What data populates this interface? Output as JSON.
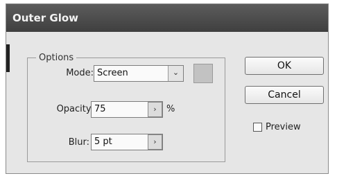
{
  "window": {
    "title": "Outer Glow"
  },
  "options": {
    "legend": "Options",
    "mode": {
      "label": "Mode:",
      "value": "Screen"
    },
    "opacity": {
      "label": "Opacity:",
      "value": "75",
      "unit": "%"
    },
    "blur": {
      "label": "Blur:",
      "value": "5 pt"
    },
    "glow_color": "#c2c2c2"
  },
  "buttons": {
    "ok": "OK",
    "cancel": "Cancel"
  },
  "preview": {
    "label": "Preview",
    "checked": false
  },
  "icons": {
    "dropdown": "chevron-down-icon",
    "stepper": "chevron-right-icon"
  }
}
